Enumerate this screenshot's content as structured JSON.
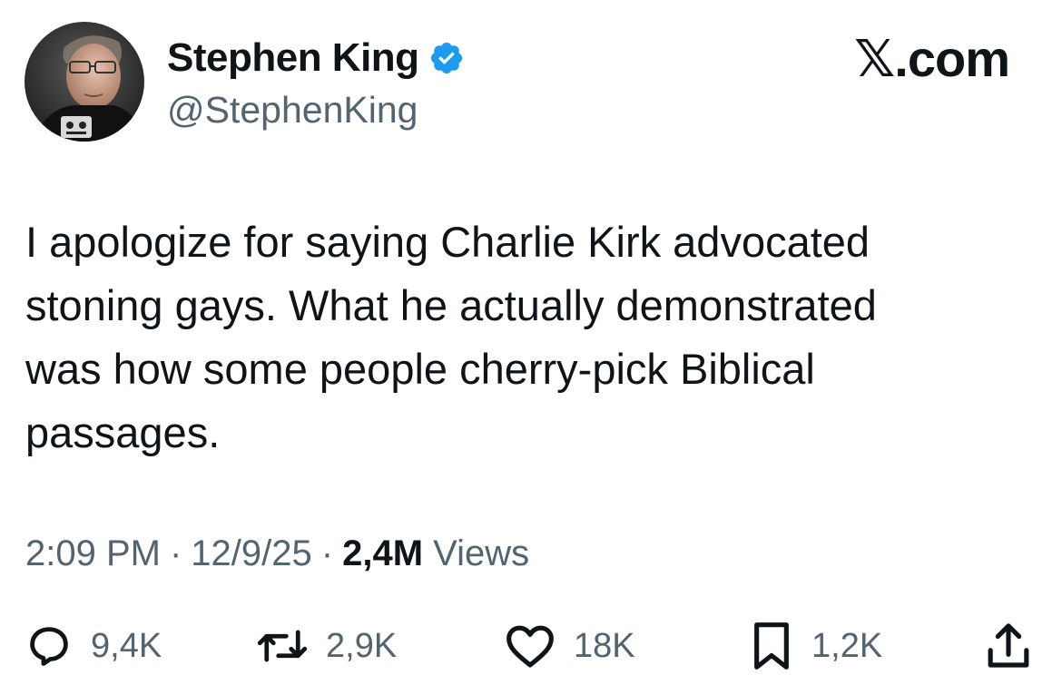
{
  "author": {
    "display_name": "Stephen King",
    "handle": "@StephenKing",
    "verified": true
  },
  "brand": {
    "label": "𝕏.com",
    "icon": "x-logo"
  },
  "tweet": {
    "text": "I apologize for saying Charlie Kirk advocated\nstoning gays. What he actually demonstrated\nwas how some people cherry-pick Biblical\npassages."
  },
  "meta": {
    "time": "2:09 PM",
    "date": "12/9/25",
    "views_count": "2,4M",
    "views_label": "Views",
    "separator": "·"
  },
  "actions": {
    "replies": {
      "icon": "reply-icon",
      "count": "9,4K"
    },
    "reposts": {
      "icon": "repost-icon",
      "count": "2,9K"
    },
    "likes": {
      "icon": "heart-icon",
      "count": "18K"
    },
    "bookmarks": {
      "icon": "bookmark-icon",
      "count": "1,2K"
    },
    "share": {
      "icon": "share-icon"
    }
  },
  "colors": {
    "text_primary": "#0f1419",
    "text_secondary": "#536471",
    "verified_badge": "#1d9bf0"
  }
}
